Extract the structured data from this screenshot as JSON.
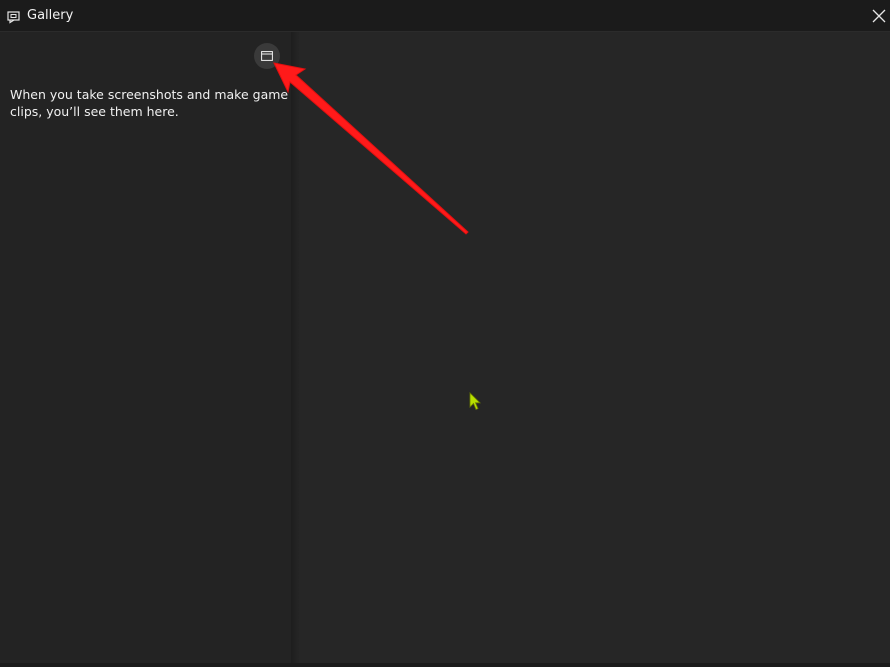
{
  "window": {
    "title": "Gallery",
    "title_icon": "gallery-icon",
    "close_icon": "close-icon"
  },
  "left_pane": {
    "folder_button_icon": "folder-icon",
    "empty_message": "When you take screenshots and make game clips, you’ll see them here."
  },
  "colors": {
    "annotation_arrow": "#ff1a1a",
    "cursor": "#b8e000"
  }
}
